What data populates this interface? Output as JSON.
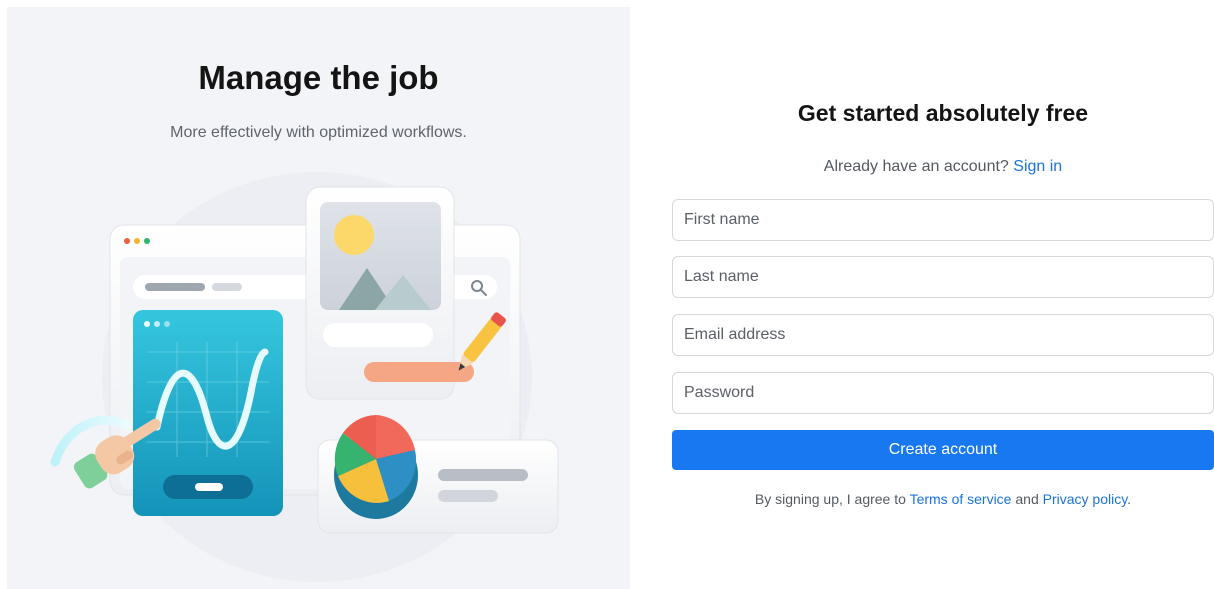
{
  "hero": {
    "title": "Manage the job",
    "subtitle": "More effectively with optimized workflows."
  },
  "form": {
    "title": "Get started absolutely free",
    "signin_prompt": "Already have an account?",
    "signin_link": "Sign in",
    "fields": {
      "first_name": {
        "placeholder": "First name",
        "value": ""
      },
      "last_name": {
        "placeholder": "Last name",
        "value": ""
      },
      "email": {
        "placeholder": "Email address",
        "value": ""
      },
      "password": {
        "placeholder": "Password",
        "value": ""
      }
    },
    "submit_label": "Create account",
    "terms": {
      "prefix": "By signing up, I agree to",
      "terms_link": "Terms of service",
      "conjunction": "and",
      "privacy_link": "Privacy policy",
      "suffix": "."
    }
  },
  "colors": {
    "accent": "#1778f2",
    "link": "#1a73d9",
    "hero_background": "#f3f4f8"
  }
}
